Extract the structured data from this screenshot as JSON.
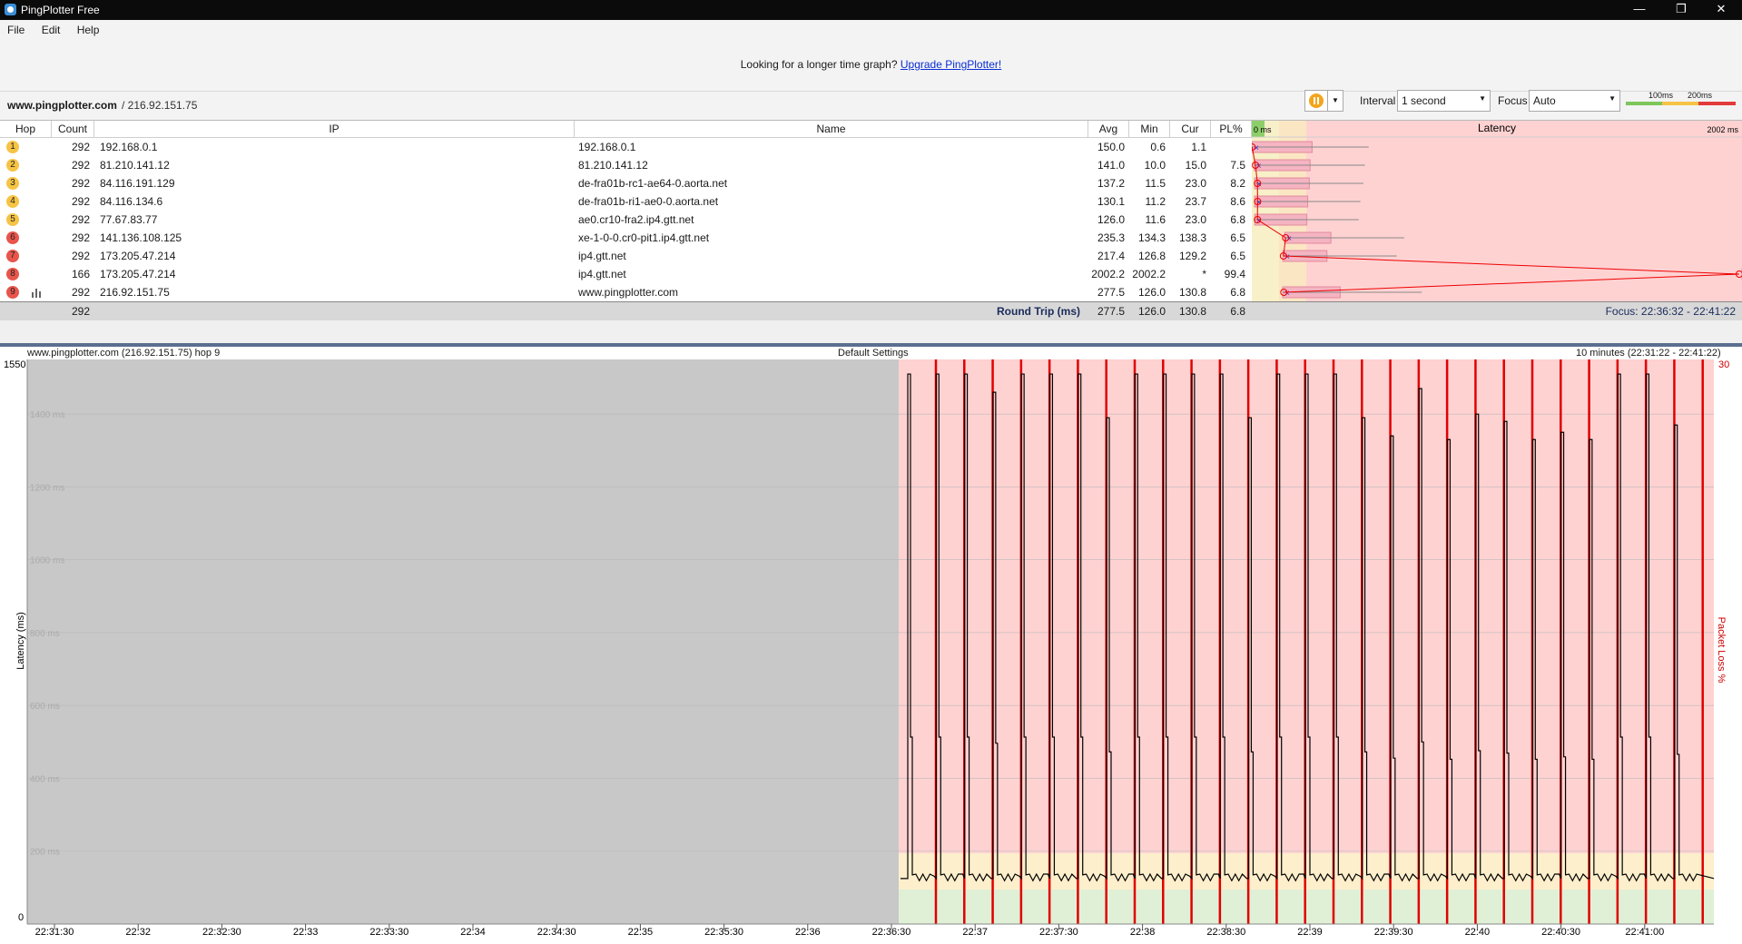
{
  "window": {
    "title": "PingPlotter Free",
    "controls": [
      "minimize-icon",
      "restore-icon",
      "close-icon"
    ]
  },
  "menu": {
    "items": [
      "File",
      "Edit",
      "Help"
    ]
  },
  "promo": {
    "text": "Looking for a longer time graph?",
    "link": "Upgrade PingPlotter!"
  },
  "target": {
    "host": "www.pingplotter.com",
    "ip": "/ 216.92.151.75"
  },
  "toolbar": {
    "interval_label": "Interval",
    "interval_value": "1 second",
    "focus_label": "Focus",
    "focus_value": "Auto",
    "threshold_low": "100ms",
    "threshold_high": "200ms",
    "colors": {
      "good": "#7dc65a",
      "warn": "#f6c445",
      "bad": "#e23b3b"
    }
  },
  "table": {
    "headers": {
      "hop": "Hop",
      "count": "Count",
      "ip": "IP",
      "name": "Name",
      "avg": "Avg",
      "min": "Min",
      "cur": "Cur",
      "pl": "PL%",
      "latency": "Latency",
      "scale_min": "0 ms",
      "scale_max": "2002 ms"
    },
    "rows": [
      {
        "hop": "1",
        "color": "#f6c445",
        "count": "292",
        "ip": "192.168.0.1",
        "name": "192.168.0.1",
        "avg": "150.0",
        "min": "0.6",
        "cur": "1.1",
        "pl": ""
      },
      {
        "hop": "2",
        "color": "#f6c445",
        "count": "292",
        "ip": "81.210.141.12",
        "name": "81.210.141.12",
        "avg": "141.0",
        "min": "10.0",
        "cur": "15.0",
        "pl": "7.5"
      },
      {
        "hop": "3",
        "color": "#f6c445",
        "count": "292",
        "ip": "84.116.191.129",
        "name": "de-fra01b-rc1-ae64-0.aorta.net",
        "avg": "137.2",
        "min": "11.5",
        "cur": "23.0",
        "pl": "8.2"
      },
      {
        "hop": "4",
        "color": "#f6c445",
        "count": "292",
        "ip": "84.116.134.6",
        "name": "de-fra01b-ri1-ae0-0.aorta.net",
        "avg": "130.1",
        "min": "11.2",
        "cur": "23.7",
        "pl": "8.6"
      },
      {
        "hop": "5",
        "color": "#f6c445",
        "count": "292",
        "ip": "77.67.83.77",
        "name": "ae0.cr10-fra2.ip4.gtt.net",
        "avg": "126.0",
        "min": "11.6",
        "cur": "23.0",
        "pl": "6.8"
      },
      {
        "hop": "6",
        "color": "#e8554b",
        "count": "292",
        "ip": "141.136.108.125",
        "name": "xe-1-0-0.cr0-pit1.ip4.gtt.net",
        "avg": "235.3",
        "min": "134.3",
        "cur": "138.3",
        "pl": "6.5"
      },
      {
        "hop": "7",
        "color": "#e8554b",
        "count": "292",
        "ip": "173.205.47.214",
        "name": "ip4.gtt.net",
        "avg": "217.4",
        "min": "126.8",
        "cur": "129.2",
        "pl": "6.5"
      },
      {
        "hop": "8",
        "color": "#e8554b",
        "count": "166",
        "ip": "173.205.47.214",
        "name": "ip4.gtt.net",
        "avg": "2002.2",
        "min": "2002.2",
        "cur": "*",
        "pl": "99.4"
      },
      {
        "hop": "9",
        "color": "#e8554b",
        "count": "292",
        "ip": "216.92.151.75",
        "name": "www.pingplotter.com",
        "avg": "277.5",
        "min": "126.0",
        "cur": "130.8",
        "pl": "6.8"
      }
    ],
    "summary": {
      "count": "292",
      "label": "Round Trip (ms)",
      "avg": "277.5",
      "min": "126.0",
      "cur": "130.8",
      "pl": "6.8",
      "focus": "Focus: 22:36:32 - 22:41:22"
    }
  },
  "graph": {
    "title_left": "www.pingplotter.com (216.92.151.75) hop 9",
    "title_center": "Default Settings",
    "title_right": "10 minutes (22:31:22 - 22:41:22)",
    "y_top_label": "1550",
    "y_bottom_label": "0",
    "y_axis_label": "Latency (ms)",
    "right_axis_top": "30",
    "right_axis_label": "Packet Loss %",
    "colors": {
      "nodata": "#c8c8c8",
      "bad": "#ffd2d2",
      "warn": "#fdefcc",
      "good": "#dff0d6",
      "loss": "#e00000"
    },
    "chart_data": {
      "type": "line",
      "ylim": [
        0,
        1550
      ],
      "y_gridlines": [
        "1400 ms",
        "1200 ms",
        "1000 ms",
        "800 ms",
        "600 ms",
        "400 ms",
        "200 ms"
      ],
      "x_ticks": [
        "22:31:30",
        "22:32",
        "22:32:30",
        "22:33",
        "22:33:30",
        "22:34",
        "22:34:30",
        "22:35",
        "22:35:30",
        "22:36",
        "22:36:30",
        "22:37",
        "22:37:30",
        "22:38",
        "22:38:30",
        "22:39",
        "22:39:30",
        "22:40",
        "22:40:30",
        "22:41:00"
      ],
      "baseline_ms": 125,
      "spike_peaks_ms": [
        1510,
        1510,
        1510,
        1460,
        1510,
        1510,
        1510,
        1390,
        1510,
        1510,
        1510,
        1510,
        1390,
        1510,
        1510,
        1510,
        1390,
        1340,
        1470,
        1330,
        1400,
        1380,
        1330,
        1350,
        1330,
        1510,
        1510,
        1370
      ]
    }
  }
}
